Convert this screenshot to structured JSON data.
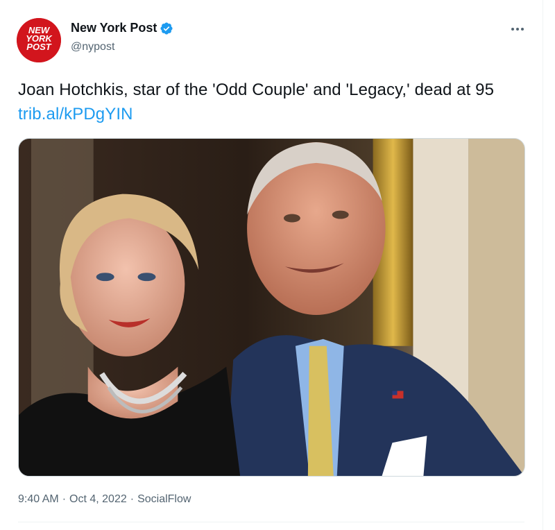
{
  "author": {
    "display_name": "New York Post",
    "handle": "@nypost",
    "logo_text": [
      "NEW",
      "YORK",
      "POST"
    ],
    "verified": true
  },
  "tweet": {
    "text": "Joan Hotchkis, star of the 'Odd Couple' and 'Legacy,' dead at 95 ",
    "link": "trib.al/kPDgYIN"
  },
  "meta": {
    "time": "9:40 AM",
    "sep1": "·",
    "date": "Oct 4, 2022",
    "sep2": "·",
    "source": "SocialFlow"
  },
  "colors": {
    "brand_red": "#d2151d",
    "link_blue": "#1d9bf0",
    "verified_blue": "#1d9bf0",
    "muted_text": "#536471"
  },
  "icons": {
    "verified": "verified-badge-icon",
    "more": "more-options-icon"
  }
}
